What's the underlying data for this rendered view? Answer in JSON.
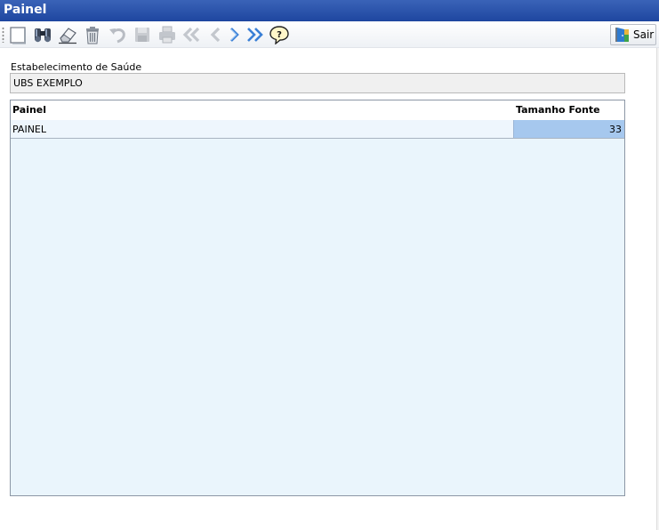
{
  "window": {
    "title": "Painel"
  },
  "toolbar": {
    "buttons": [
      {
        "icon": "new-document-icon",
        "enabled": true
      },
      {
        "icon": "binoculars-search-icon",
        "enabled": true
      },
      {
        "icon": "eraser-icon",
        "enabled": true
      },
      {
        "icon": "trash-icon",
        "enabled": true
      },
      {
        "icon": "undo-icon",
        "enabled": false
      },
      {
        "icon": "save-icon",
        "enabled": false
      },
      {
        "icon": "print-icon",
        "enabled": false
      },
      {
        "icon": "first-record-icon",
        "enabled": false
      },
      {
        "icon": "previous-record-icon",
        "enabled": false
      },
      {
        "icon": "next-record-icon",
        "enabled": true
      },
      {
        "icon": "last-record-icon",
        "enabled": true
      },
      {
        "icon": "help-icon",
        "enabled": true
      }
    ],
    "exit_label": "Sair"
  },
  "form": {
    "estabelecimento_label": "Estabelecimento de Saúde",
    "estabelecimento_value": "UBS EXEMPLO"
  },
  "grid": {
    "columns": [
      "Painel",
      "Tamanho Fonte"
    ],
    "rows": [
      {
        "painel": "PAINEL",
        "tamanho_fonte": "33"
      }
    ]
  },
  "colors": {
    "titlebar": "#2a52ab",
    "grid_background": "#eaf5fc",
    "selected_cell": "#a6c8ee",
    "accent_blue": "#3a7fd6"
  }
}
